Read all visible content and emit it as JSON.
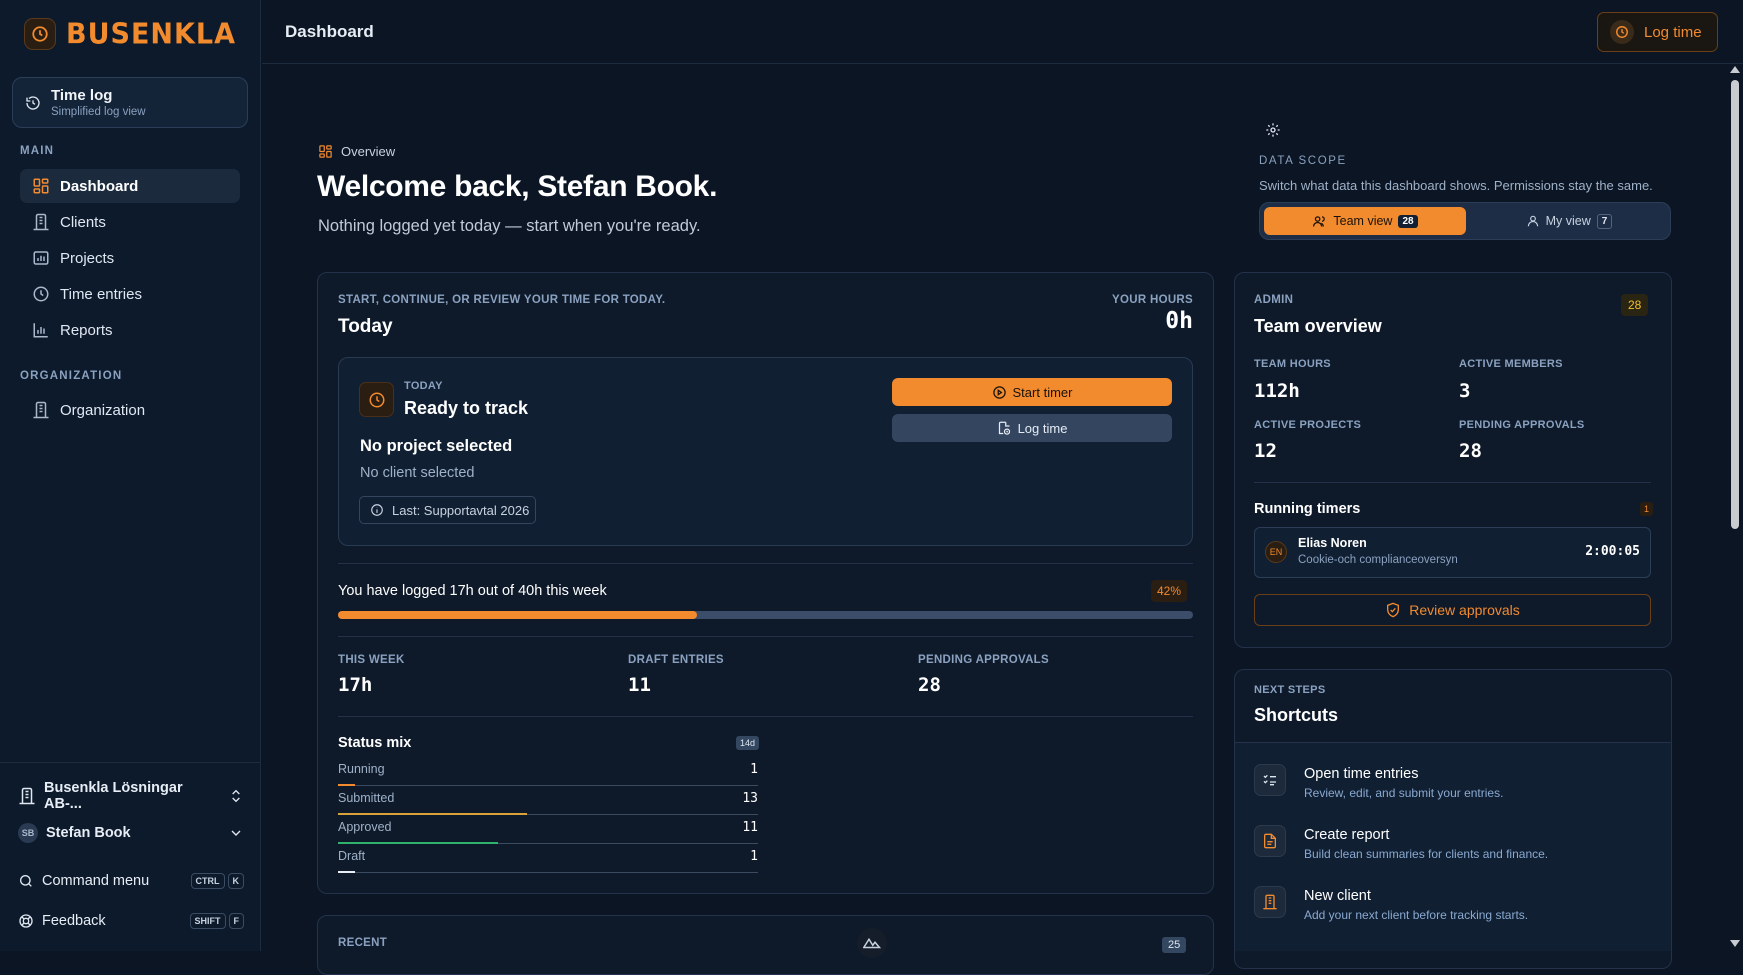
{
  "brand": {
    "name": "BUSENKLA"
  },
  "sidebar": {
    "timelog": {
      "title": "Time log",
      "subtitle": "Simplified log view"
    },
    "main_label": "MAIN",
    "items": [
      {
        "label": "Dashboard",
        "icon": "dashboard-icon",
        "active": true
      },
      {
        "label": "Clients",
        "icon": "building-icon"
      },
      {
        "label": "Projects",
        "icon": "projects-icon"
      },
      {
        "label": "Time entries",
        "icon": "clock-icon"
      },
      {
        "label": "Reports",
        "icon": "chart-icon"
      }
    ],
    "org_label": "ORGANIZATION",
    "org_items": [
      {
        "label": "Organization",
        "icon": "building-icon"
      }
    ],
    "org_switcher": "Busenkla Lösningar AB-...",
    "user": {
      "initials": "SB",
      "name": "Stefan Book"
    },
    "command": {
      "label": "Command menu",
      "keys": [
        "CTRL",
        "K"
      ]
    },
    "feedback": {
      "label": "Feedback",
      "keys": [
        "SHIFT",
        "F"
      ]
    }
  },
  "topbar": {
    "title": "Dashboard",
    "log_time": "Log time"
  },
  "header": {
    "eyebrow": "Overview",
    "welcome": "Welcome back, Stefan Book.",
    "subtitle": "Nothing logged yet today — start when you're ready."
  },
  "scope": {
    "label": "DATA SCOPE",
    "description": "Switch what data this dashboard shows. Permissions stay the same.",
    "team": {
      "label": "Team view",
      "count": "28"
    },
    "mine": {
      "label": "My view",
      "count": "7"
    }
  },
  "today": {
    "eyebrow": "START, CONTINUE, OR REVIEW YOUR TIME FOR TODAY.",
    "title": "Today",
    "hours_label": "YOUR HOURS",
    "hours": "0h",
    "inner": {
      "eyebrow": "TODAY",
      "title": "Ready to track",
      "project": "No project selected",
      "client": "No client selected",
      "last": "Last: Supportavtal 2026",
      "start_timer": "Start timer",
      "log_time": "Log time"
    },
    "week_text": "You have logged 17h out of 40h this week",
    "week_pct": "42%",
    "week_fraction": 0.42,
    "stats": [
      {
        "label": "THIS WEEK",
        "value": "17h"
      },
      {
        "label": "DRAFT ENTRIES",
        "value": "11"
      },
      {
        "label": "PENDING APPROVALS",
        "value": "28"
      }
    ],
    "status_mix": {
      "title": "Status mix",
      "badge": "14d",
      "rows": [
        {
          "label": "Running",
          "value": "1",
          "fraction": 0.04,
          "color": "#f28a2e"
        },
        {
          "label": "Submitted",
          "value": "13",
          "fraction": 0.45,
          "color": "#d9a13a"
        },
        {
          "label": "Approved",
          "value": "11",
          "fraction": 0.38,
          "color": "#2fb36a"
        },
        {
          "label": "Draft",
          "value": "1",
          "fraction": 0.04,
          "color": "#e6edf5"
        }
      ]
    }
  },
  "recent": {
    "label": "RECENT",
    "count": "25"
  },
  "team": {
    "eyebrow": "ADMIN",
    "title": "Team overview",
    "badge": "28",
    "stats": [
      {
        "label": "TEAM HOURS",
        "value": "112h"
      },
      {
        "label": "ACTIVE MEMBERS",
        "value": "3"
      },
      {
        "label": "ACTIVE PROJECTS",
        "value": "12"
      },
      {
        "label": "PENDING APPROVALS",
        "value": "28"
      }
    ],
    "running_title": "Running timers",
    "running_count": "1",
    "timer": {
      "initials": "EN",
      "name": "Elias Noren",
      "project": "Cookie-och complianceoversyn",
      "elapsed": "2:00:05"
    },
    "review": "Review approvals"
  },
  "shortcuts": {
    "eyebrow": "NEXT STEPS",
    "title": "Shortcuts",
    "items": [
      {
        "title": "Open time entries",
        "desc": "Review, edit, and submit your entries.",
        "icon": "checklist-icon"
      },
      {
        "title": "Create report",
        "desc": "Build clean summaries for clients and finance.",
        "icon": "document-icon"
      },
      {
        "title": "New client",
        "desc": "Add your next client before tracking starts.",
        "icon": "building-icon"
      }
    ]
  }
}
